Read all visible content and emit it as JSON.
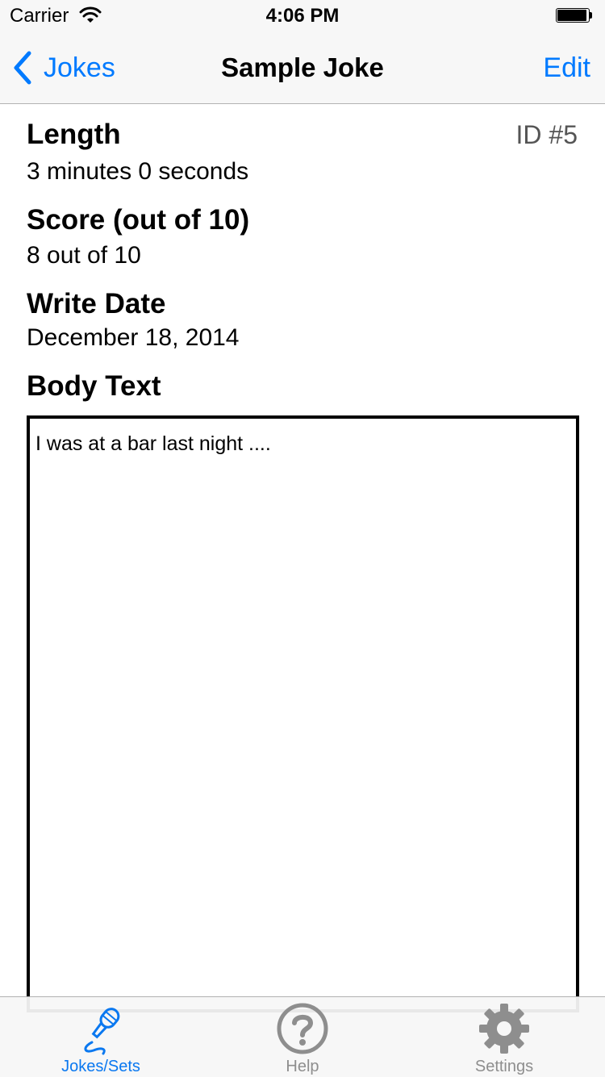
{
  "status_bar": {
    "carrier": "Carrier",
    "time": "4:06 PM",
    "battery_level": 0.95
  },
  "nav": {
    "back_label": "Jokes",
    "title": "Sample Joke",
    "edit_label": "Edit"
  },
  "joke": {
    "id_label": "ID #5",
    "fields": [
      {
        "heading": "Length",
        "value": "3 minutes 0 seconds"
      },
      {
        "heading": "Score (out of 10)",
        "value": "8 out of 10"
      },
      {
        "heading": "Write Date",
        "value": "December 18, 2014"
      }
    ],
    "body_heading": "Body Text",
    "body_text": "I was at a bar last night ...."
  },
  "tab_bar": {
    "tabs": [
      {
        "label": "Jokes/Sets",
        "icon": "microphone-icon",
        "selected": true
      },
      {
        "label": "Help",
        "icon": "question-mark-icon",
        "selected": false
      },
      {
        "label": "Settings",
        "icon": "gear-icon",
        "selected": false
      }
    ]
  },
  "colors": {
    "accent": "#007aff",
    "inactive_tab": "#8e8e8e",
    "bar_background": "#f7f7f7"
  }
}
